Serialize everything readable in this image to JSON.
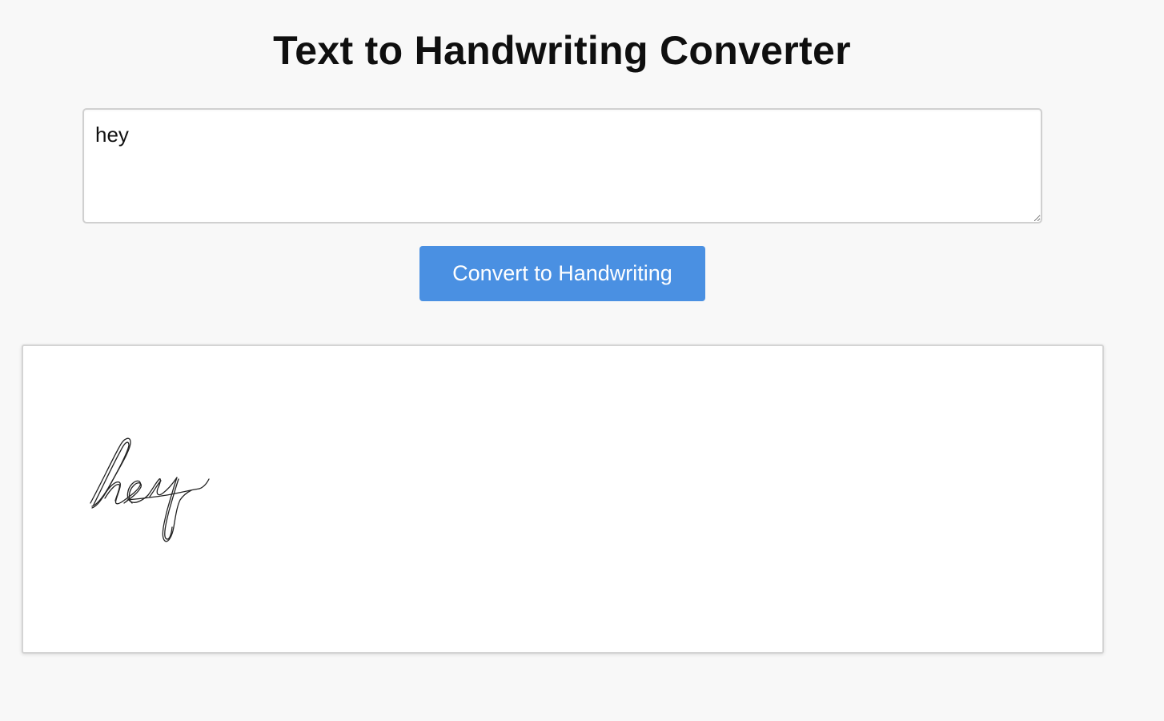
{
  "page": {
    "title": "Text to Handwriting Converter"
  },
  "input": {
    "value": "hey"
  },
  "actions": {
    "convert_label": "Convert to Handwriting"
  },
  "output": {
    "rendered_text": "hey"
  },
  "colors": {
    "button_bg": "#4a90e2",
    "page_bg": "#f8f8f8"
  }
}
